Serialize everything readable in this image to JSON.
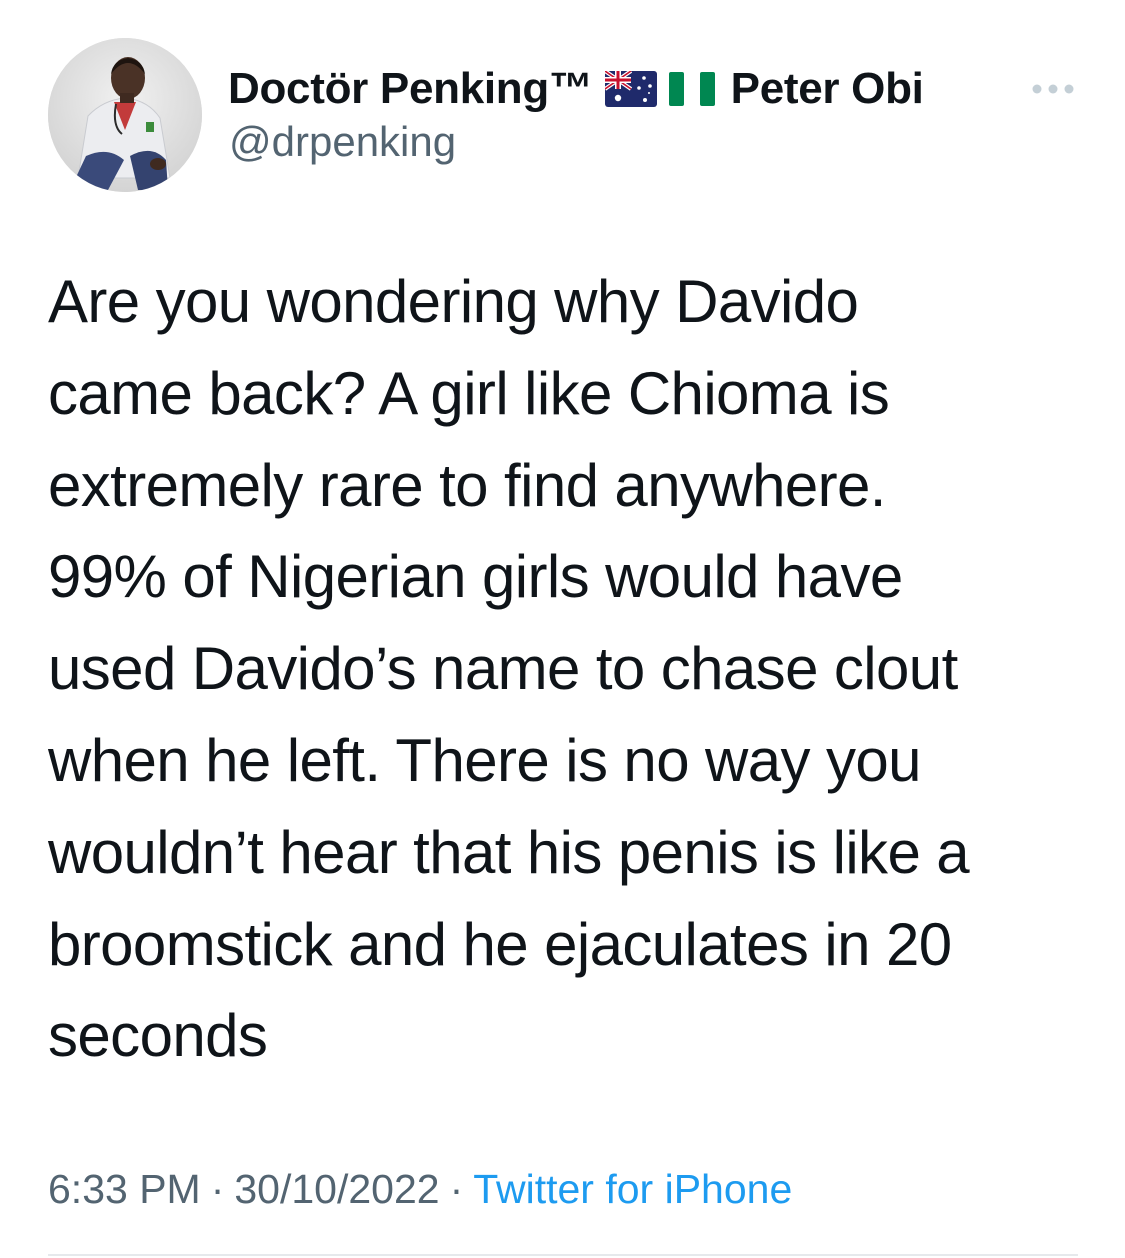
{
  "author": {
    "display_name": "Doctör Penking™",
    "flags": [
      "australia-flag",
      "nigeria-flag"
    ],
    "name_suffix": "Peter Obi",
    "handle": "@drpenking",
    "avatar_icon": "profile-photo-doctor"
  },
  "more_icon": "ellipsis-icon",
  "tweet": {
    "lines": [
      "Are you wondering why Davido",
      "came back? A girl like Chioma is",
      "extremely rare to find anywhere.",
      "99% of Nigerian girls would have",
      "used Davido’s name to chase clout",
      "when he left. There is no way you",
      "wouldn’t hear that his penis is like a",
      "broomstick and he ejaculates in 20",
      "seconds"
    ]
  },
  "meta": {
    "time": "6:33 PM",
    "separator": "·",
    "date": "30/10/2022",
    "source": "Twitter for iPhone"
  },
  "colors": {
    "text_primary": "#0f1419",
    "text_secondary": "#536471",
    "link": "#1d9bf0",
    "nigeria_green": "#008751"
  }
}
